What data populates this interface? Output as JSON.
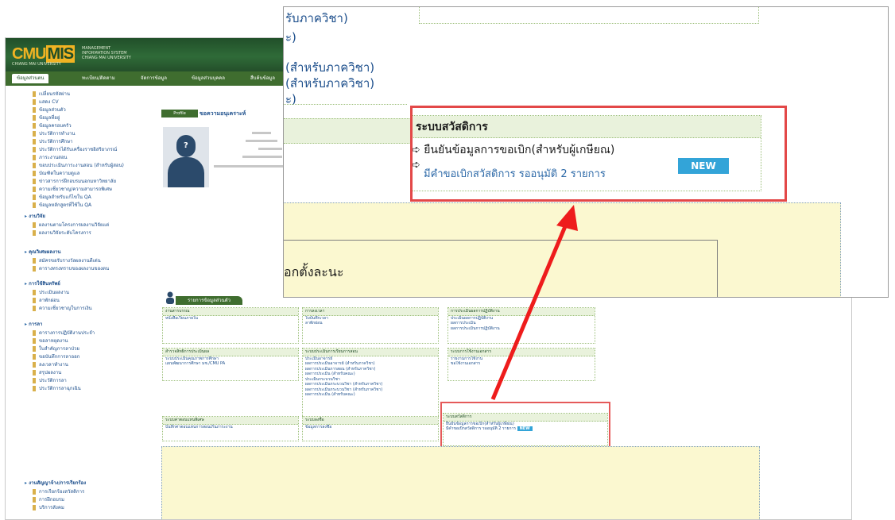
{
  "app": {
    "logo": "CMU MIS",
    "logo_main": "CMU",
    "logo_mis": "MIS",
    "logo_sub": "CHIANG MAI UNIVERSITY",
    "logo_text": "MANAGEMENT INFORMATION SYSTEM CHIANG MAI UNIVERSITY"
  },
  "nav": {
    "tabs": [
      "ข้อมูลส่วนตน",
      "ทะเบียน/ติดตาม",
      "จัดการข้อมูล",
      "ข้อมูลส่วนบุคคล",
      "สืบค้นข้อมูล"
    ]
  },
  "sidebar": {
    "items": [
      "เปลี่ยนรหัสผ่าน",
      "แสดง CV",
      "ข้อมูลส่วนตัว",
      "ข้อมูลที่อยู่",
      "ข้อมูลครอบครัว",
      "ประวัติการทำงาน",
      "ประวัติการศึกษา",
      "ประวัติการได้รับเครื่องราชอิสริยาภรณ์",
      "ภาระงานสอน",
      "ขอบประเมินภาระงานสอน (สำหรับผู้สอน)",
      "บัณฑิตในความดูแล",
      "ข่าวสารการฝึกอบรมนอกมหาวิทยาลัย",
      "ความเชี่ยวชาญ/ความสามารถพิเศษ",
      "ข้อมูลสำหรับแก้ไขใน QA",
      "ข้อมูลหลักสูตรที่ใช้ใน QA"
    ],
    "sections": [
      {
        "title": "งานวิจัย",
        "items": [
          "ผลงานตามโครงการผลงานวิจัยแต่",
          "ผลงานวิจัยระดับโครงการ"
        ]
      },
      {
        "title": "คุณวิเศษผลงาน",
        "items": [
          "สมัครขอรับรางวัลผลงานดีเด่น",
          "ตารางทรงทราบของผลงานของตน"
        ]
      },
      {
        "title": "การใช้สินทรัพย์",
        "items": [
          "ประเมินผลงาน",
          "ลาพักผ่อน",
          "ความเชี่ยวชาญในการเงิน"
        ]
      },
      {
        "title": "การลา",
        "items": [
          "ตารางการปฏิบัติงานประจำ",
          "ขอลาหยุดงาน",
          "ใบสำคัญการลาป่วย",
          "ขอบันทึกการลาออก",
          "ลงเวลาทำงาน",
          "สรุปผลงาน",
          "ประวัติการลา",
          "ประวัติการลาฉุกเฉิน"
        ]
      },
      {
        "title": "งานสัญญาจ้าง/การเรียกร้อง",
        "items": [
          "การเรียกร้องสวัสดิการ",
          "การฝึกอบรม",
          "บริการสังคม"
        ]
      }
    ]
  },
  "profile": {
    "tab": "Profile",
    "text": "ขอความอนุเคราะห์"
  },
  "services": {
    "tab_label": "รายการข้อมูลส่วนตัว",
    "boxes": [
      {
        "title": "งานสารบรรณ",
        "lines": [
          "หนังสือเวียนภายใน"
        ]
      },
      {
        "title": "การลงเวลา",
        "lines": [
          "ใบบันทึกเวลา",
          "ลาพักผ่อน"
        ]
      },
      {
        "title": "การประเมินผลการปฏิบัติงาน",
        "lines": [
          "ประเมินผลการปฏิบัติงาน",
          "ผลการประเมิน",
          "ผลการประเมินการปฏิบัติงาน"
        ]
      },
      {
        "title": "สำรวจสิทธิการประเมินผล",
        "lines": [
          "ระบบประเมินคุณภาพการศึกษา",
          "แผนพัฒนาการศึกษา มช./CMU PA"
        ]
      },
      {
        "title": "ระบบประเมินการเรียนการสอน",
        "lines": [
          "ประเมินอาจารย์",
          "ผลการประเมินอาจารย์ (สำหรับภาควิชา)",
          "ผลการประเมินการสอน (สำหรับภาควิชา)",
          "ผลการประเมิน (สำหรับคณะ)",
          "ประเมินกระบวนวิชา",
          "ผลการประเมินกระบวนวิชา (สำหรับภาควิชา)",
          "ผลการประเมินกระบวนวิชา (สำหรับภาควิชา)",
          "ผลการประเมิน (สำหรับคณะ)"
        ]
      },
      {
        "title": "ระบบการใช้งานเอกสาร",
        "lines": [
          "รายงานการใช้งาน",
          "ขอใช้งานเอกสาร"
        ]
      },
      {
        "title": "ระบบค่าตอบแทนพิเศษ",
        "lines": [
          "บันทึกค่าตอบแทนการสอนเกินภาระงาน"
        ]
      },
      {
        "title": "ระบบลงชื่อ",
        "lines": [
          "ข้อมูลการลงชื่อ"
        ]
      },
      {
        "title": "ระบบสวัสดิการ",
        "lines": [
          "ยืนยันข้อมูลการขอเบิก(สำหรับผู้เกษียณ)",
          "มีคำขอเบิกสวัสดิการ รออนุมัติ 2 รายการ"
        ]
      }
    ],
    "new_badge": "NEW"
  },
  "zoom": {
    "frag1": "รับภาควิชา)",
    "frag2": "ะ)",
    "frag3": "(สำหรับภาควิชา)",
    "frag4": "(สำหรับภาควิชา)",
    "frag5": "ะ)",
    "welfare_title": "ระบบสวัสดิการ",
    "welfare_confirm": "ยืนยันข้อมูลการขอเบิก(สำหรับผู้เกษียณ)",
    "welfare_pending": "มีคำขอเบิกสวัสดิการ รออนุมัติ 2 รายการ",
    "new_badge": "NEW",
    "bottom_text": "อกตั้งละนะ",
    "arrow_char": "➪"
  },
  "colors": {
    "header_green": "#2f6b38",
    "nav_green": "#3f6d2f",
    "logo_gold": "#f0b323",
    "link_blue": "#1d4f8c",
    "panel_yellow": "#fbf8d0",
    "panel_green": "#e9f2dc",
    "highlight_red": "#e34848",
    "new_badge_blue": "#33a4d8"
  }
}
